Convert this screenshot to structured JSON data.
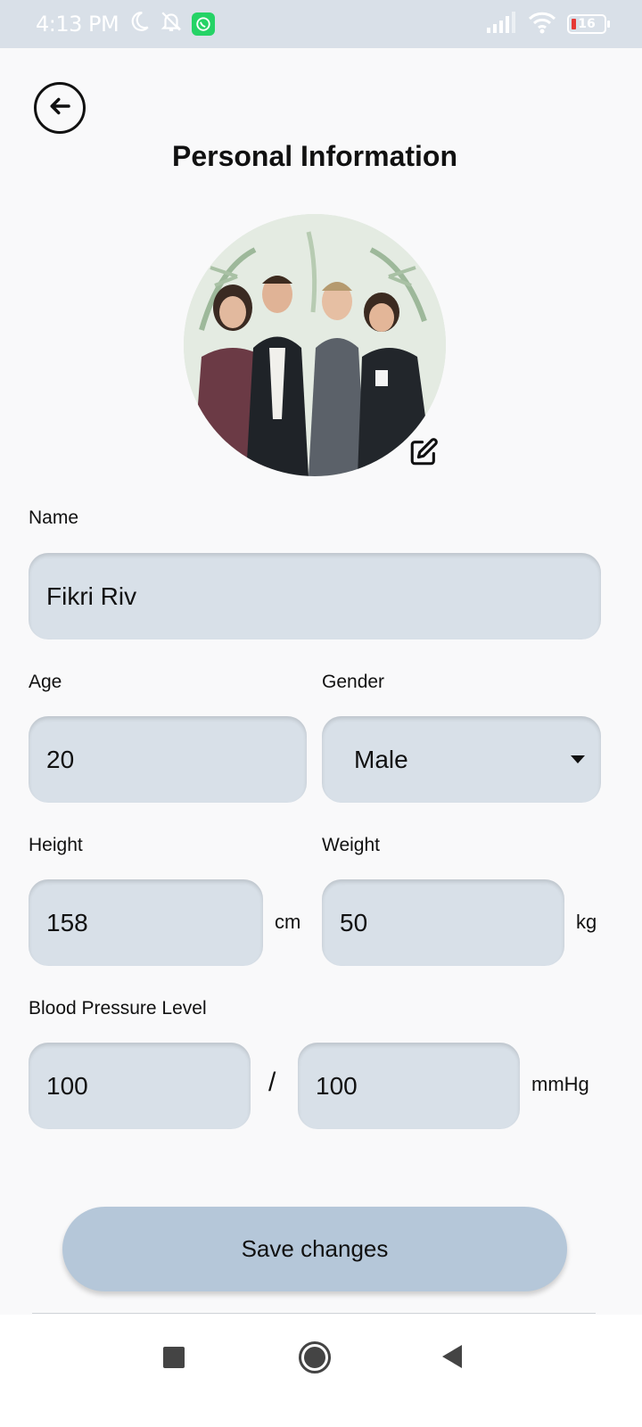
{
  "status_bar": {
    "time": "4:13 PM",
    "battery_level": "16",
    "icons": [
      "moon-icon",
      "bell-off-icon",
      "whatsapp-icon",
      "signal-icon",
      "wifi-icon",
      "battery-icon"
    ]
  },
  "header": {
    "title": "Personal Information"
  },
  "form": {
    "name_label": "Name",
    "name_value": "Fikri Riv",
    "age_label": "Age",
    "age_value": "20",
    "gender_label": "Gender",
    "gender_value": "Male",
    "height_label": "Height",
    "height_value": "158",
    "height_unit": "cm",
    "weight_label": "Weight",
    "weight_value": "50",
    "weight_unit": "kg",
    "bp_label": "Blood Pressure Level",
    "bp_systolic": "100",
    "bp_separator": "/",
    "bp_diastolic": "100",
    "bp_unit": "mmHg"
  },
  "actions": {
    "save_label": "Save changes"
  },
  "colors": {
    "field_bg": "#d8e0e8",
    "button_bg": "#b5c7d9",
    "status_bar_bg": "#d9e0e8"
  }
}
